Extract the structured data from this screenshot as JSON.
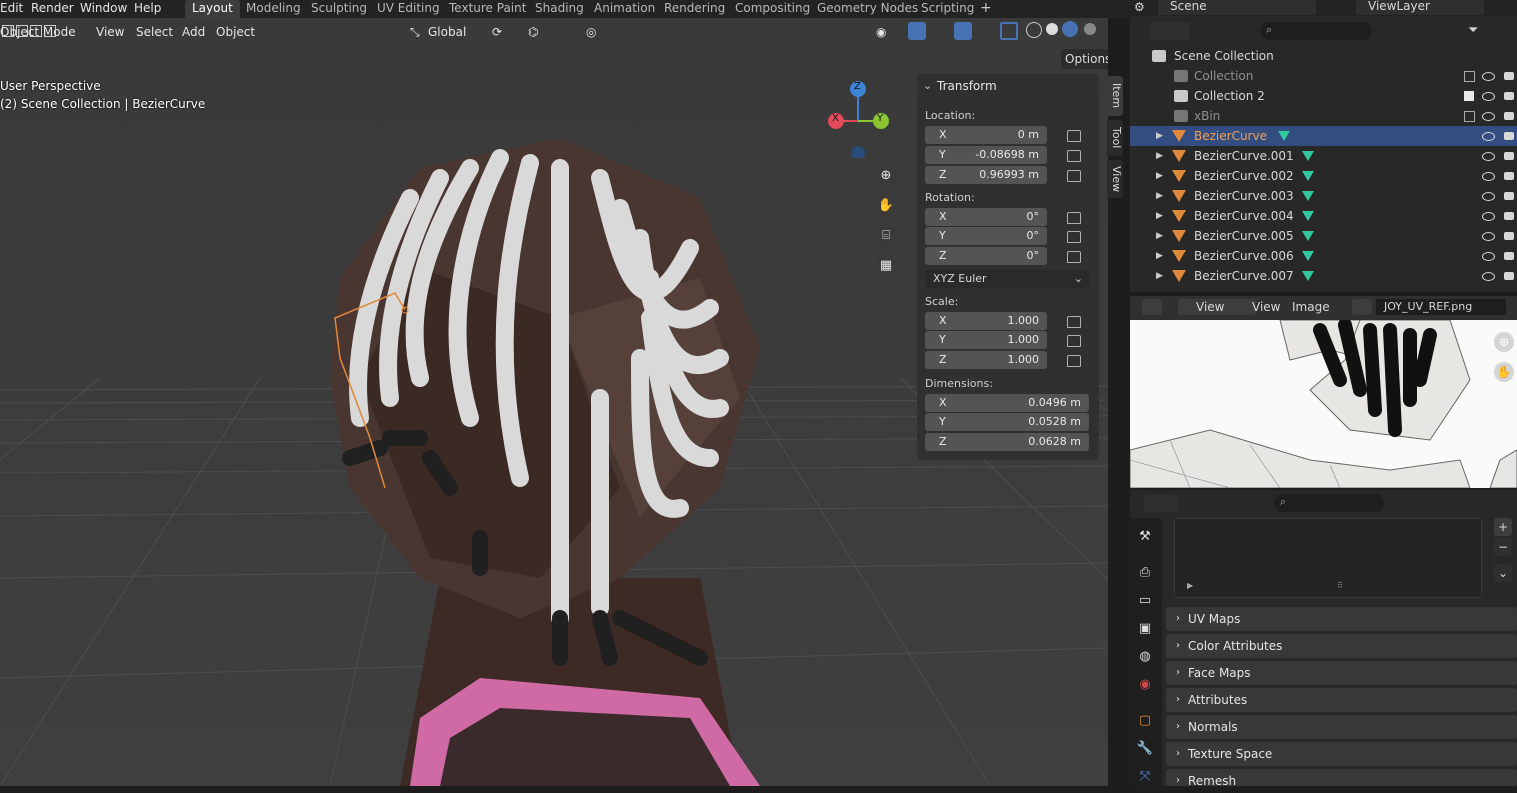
{
  "topbar": {
    "menus": [
      "Edit",
      "Render",
      "Window",
      "Help"
    ],
    "workspaces": [
      "Layout",
      "Modeling",
      "Sculpting",
      "UV Editing",
      "Texture Paint",
      "Shading",
      "Animation",
      "Rendering",
      "Compositing",
      "Geometry Nodes",
      "Scripting"
    ],
    "active_workspace": "Layout",
    "add_tab": "+"
  },
  "viewport": {
    "mode": "Object Mode",
    "menus": [
      "View",
      "Select",
      "Add",
      "Object"
    ],
    "transform_orientation": "Global",
    "options_label": "Options",
    "overlay_line1": "User Perspective",
    "overlay_line2": "(2) Scene Collection | BezierCurve",
    "gizmo": {
      "z": "Z",
      "y": "Y",
      "x": "X"
    },
    "side_tabs": [
      "Item",
      "Tool",
      "View"
    ]
  },
  "transform_panel": {
    "title": "Transform",
    "location_label": "Location:",
    "location": [
      {
        "axis": "X",
        "value": "0 m"
      },
      {
        "axis": "Y",
        "value": "-0.08698 m"
      },
      {
        "axis": "Z",
        "value": "0.96993 m"
      }
    ],
    "rotation_label": "Rotation:",
    "rotation": [
      {
        "axis": "X",
        "value": "0°"
      },
      {
        "axis": "Y",
        "value": "0°"
      },
      {
        "axis": "Z",
        "value": "0°"
      }
    ],
    "rotation_mode": "XYZ Euler",
    "scale_label": "Scale:",
    "scale": [
      {
        "axis": "X",
        "value": "1.000"
      },
      {
        "axis": "Y",
        "value": "1.000"
      },
      {
        "axis": "Z",
        "value": "1.000"
      }
    ],
    "dimensions_label": "Dimensions:",
    "dimensions": [
      {
        "axis": "X",
        "value": "0.0496 m"
      },
      {
        "axis": "Y",
        "value": "0.0528 m"
      },
      {
        "axis": "Z",
        "value": "0.0628 m"
      }
    ]
  },
  "outliner": {
    "scene": "Scene",
    "view_layer": "ViewLayer",
    "root": "Scene Collection",
    "collections": [
      "Collection",
      "Collection 2",
      "xBin"
    ],
    "objects": [
      "BezierCurve",
      "BezierCurve.001",
      "BezierCurve.002",
      "BezierCurve.003",
      "BezierCurve.004",
      "BezierCurve.005",
      "BezierCurve.006",
      "BezierCurve.007"
    ],
    "selected": "BezierCurve"
  },
  "image_editor": {
    "view_label": "View",
    "menus": [
      "View",
      "Image"
    ],
    "image_name": "JOY_UV_REF.png"
  },
  "properties": {
    "sections": [
      "UV Maps",
      "Color Attributes",
      "Face Maps",
      "Attributes",
      "Normals",
      "Texture Space",
      "Remesh"
    ]
  },
  "colors": {
    "accent_blue": "#4772b3",
    "curve_orange": "#e0893a",
    "data_green": "#31c8a0",
    "gizmo_x": "#e24b5a",
    "gizmo_y": "#8bc532",
    "gizmo_z": "#3d84d6"
  }
}
